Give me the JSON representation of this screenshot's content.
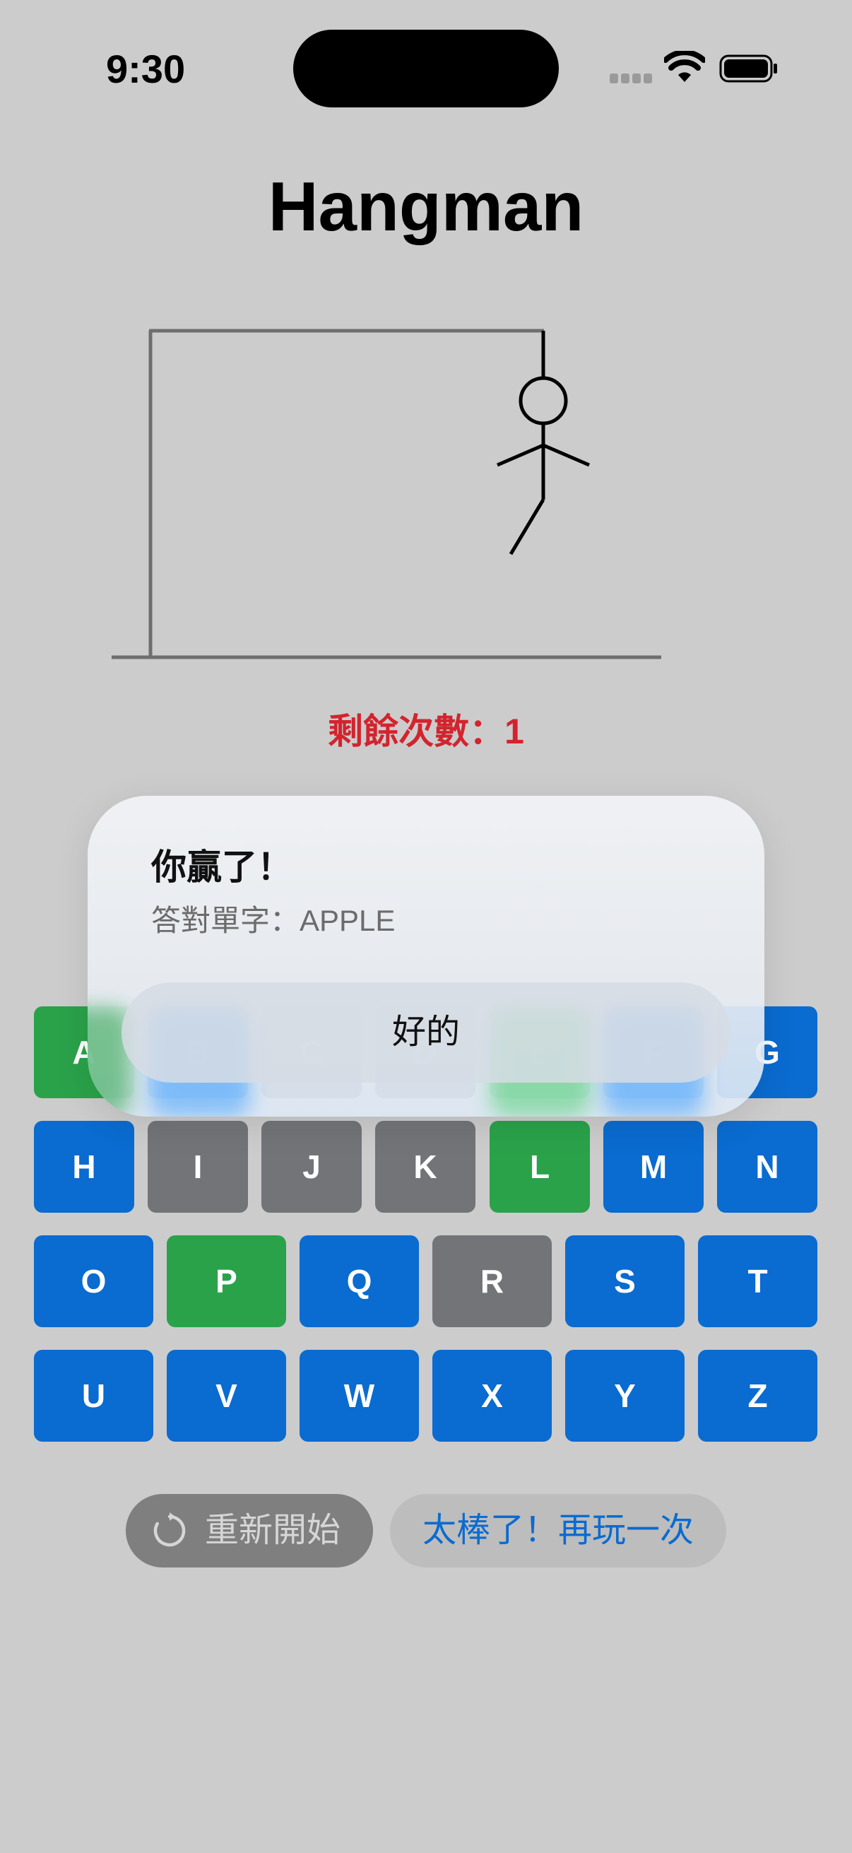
{
  "status_bar": {
    "time": "9:30"
  },
  "title": "Hangman",
  "hangman": {
    "remaining_label": "剩餘次數：1",
    "drawn_parts": [
      "head",
      "body",
      "left-arm",
      "right-arm",
      "left-leg"
    ]
  },
  "word": {
    "letters": [
      "A",
      "P",
      "P",
      "L",
      "E"
    ]
  },
  "keyboard": {
    "rows": [
      [
        {
          "letter": "A",
          "state": "correct"
        },
        {
          "letter": "B",
          "state": "unused"
        },
        {
          "letter": "C",
          "state": "wrong"
        },
        {
          "letter": "D",
          "state": "wrong"
        },
        {
          "letter": "E",
          "state": "correct"
        },
        {
          "letter": "F",
          "state": "unused"
        },
        {
          "letter": "G",
          "state": "unused"
        }
      ],
      [
        {
          "letter": "H",
          "state": "unused"
        },
        {
          "letter": "I",
          "state": "wrong"
        },
        {
          "letter": "J",
          "state": "wrong"
        },
        {
          "letter": "K",
          "state": "wrong"
        },
        {
          "letter": "L",
          "state": "correct"
        },
        {
          "letter": "M",
          "state": "unused"
        },
        {
          "letter": "N",
          "state": "unused"
        }
      ],
      [
        {
          "letter": "O",
          "state": "unused"
        },
        {
          "letter": "P",
          "state": "correct"
        },
        {
          "letter": "Q",
          "state": "unused"
        },
        {
          "letter": "R",
          "state": "wrong"
        },
        {
          "letter": "S",
          "state": "unused"
        },
        {
          "letter": "T",
          "state": "unused"
        }
      ],
      [
        {
          "letter": "U",
          "state": "unused"
        },
        {
          "letter": "V",
          "state": "unused"
        },
        {
          "letter": "W",
          "state": "unused"
        },
        {
          "letter": "X",
          "state": "unused"
        },
        {
          "letter": "Y",
          "state": "unused"
        },
        {
          "letter": "Z",
          "state": "unused"
        }
      ]
    ],
    "colors": {
      "unused": "#0a6bd0",
      "wrong": "#737478",
      "correct": "#2aa24a"
    }
  },
  "alert": {
    "title": "你贏了！",
    "message": "答對單字：APPLE",
    "ok_label": "好的"
  },
  "actions": {
    "restart_label": "重新開始",
    "restart_icon": "restart-icon",
    "play_again_label": "太棒了！再玩一次"
  }
}
